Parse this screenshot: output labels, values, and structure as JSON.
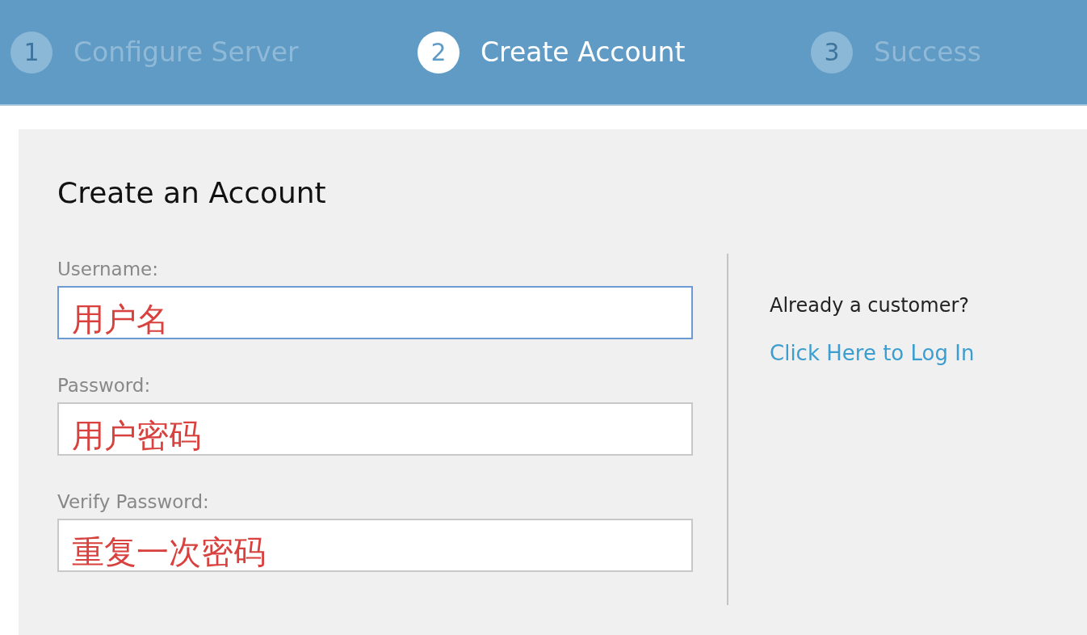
{
  "steps": [
    {
      "number": "1",
      "label": "Configure Server",
      "selected": false
    },
    {
      "number": "2",
      "label": "Create Account",
      "selected": true
    },
    {
      "number": "3",
      "label": "Success",
      "selected": false
    }
  ],
  "form": {
    "title": "Create an Account",
    "fields": [
      {
        "label": "Username:",
        "value": "用户名",
        "focused": true
      },
      {
        "label": "Password:",
        "value": "用户密码",
        "focused": false
      },
      {
        "label": "Verify Password:",
        "value": "重复一次密码",
        "focused": false
      }
    ]
  },
  "sidebar": {
    "prompt": "Already a customer?",
    "link": "Click Here to Log In"
  }
}
